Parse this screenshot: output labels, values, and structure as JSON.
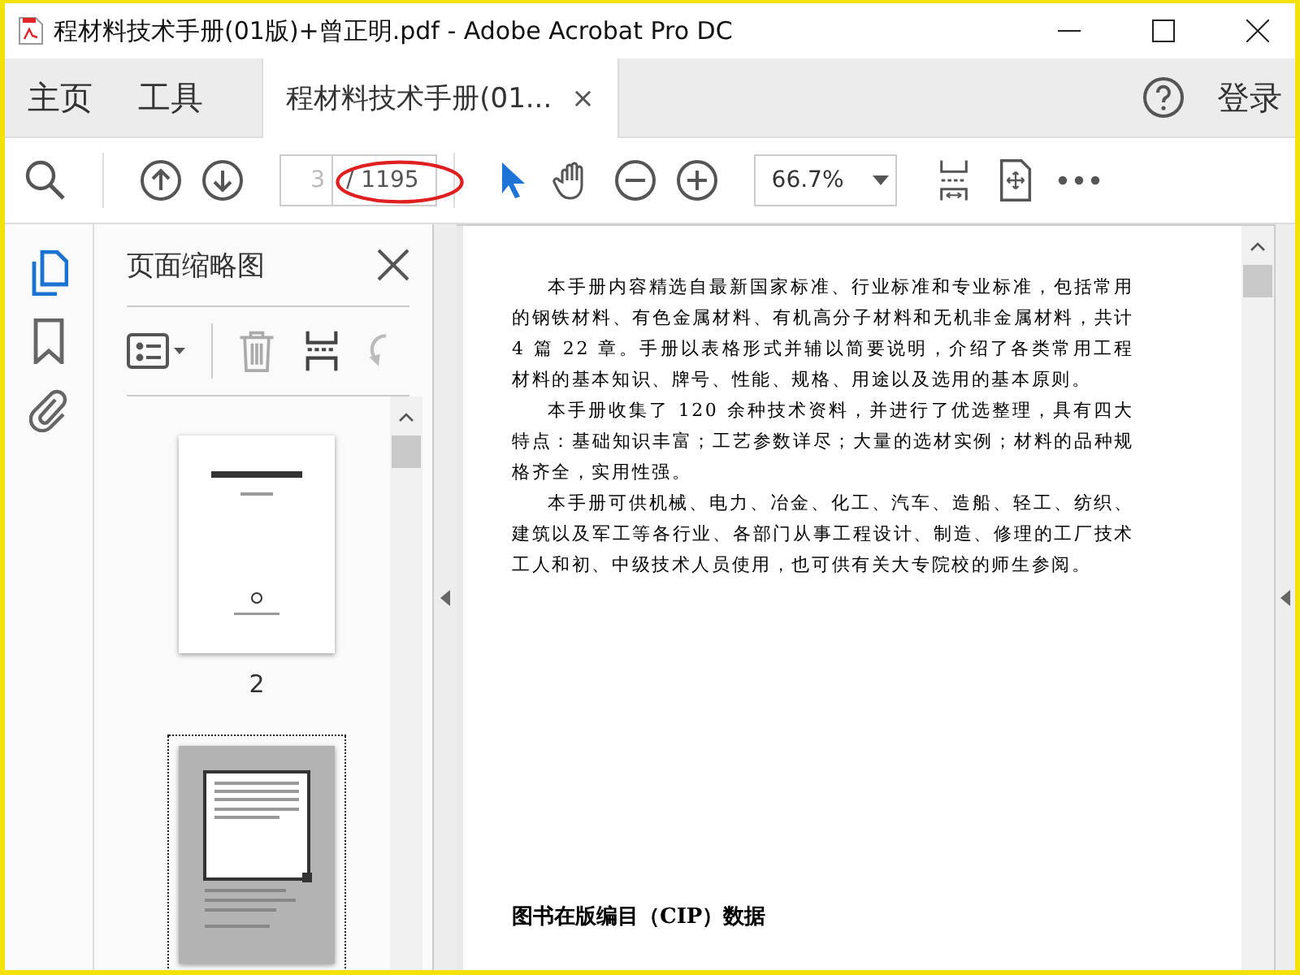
{
  "window": {
    "title": "程材料技术手册(01版)+曾正明.pdf - Adobe Acrobat Pro DC"
  },
  "nav": [
    {
      "label": "主页",
      "selected": false
    },
    {
      "label": "工具",
      "selected": false
    }
  ],
  "doc_tab": {
    "label": "程材料技术手册(01...",
    "close": "×",
    "selected": true
  },
  "signin": "登录",
  "toolbar": {
    "page_value": "3",
    "page_total": "/ 1195",
    "zoom": "66.7%"
  },
  "sidebar": {
    "items": [
      {
        "kind": "pages",
        "selected": true
      },
      {
        "kind": "bookmarks",
        "selected": false
      },
      {
        "kind": "attachments",
        "selected": false
      }
    ]
  },
  "panel": {
    "title": "页面缩略图",
    "thumbnails": [
      {
        "label": "2",
        "selected": false
      },
      {
        "selected": true
      }
    ]
  },
  "document": {
    "paragraphs": [
      "本手册内容精选自最新国家标准、行业标准和专业标准，包括常用的钢铁材料、有色金属材料、有机高分子材料和无机非金属材料，共计 4 篇 22 章。手册以表格形式并辅以简要说明，介绍了各类常用工程材料的基本知识、牌号、性能、规格、用途以及选用的基本原则。",
      "本手册收集了 120 余种技术资料，并进行了优选整理，具有四大特点：基础知识丰富；工艺参数详尽；大量的选材实例；材料的品种规格齐全，实用性强。",
      "本手册可供机械、电力、冶金、化工、汽车、造船、轻工、纺织、建筑以及军工等各行业、各部门从事工程设计、制造、修理的工厂技术工人和初、中级技术人员使用，也可供有关大专院校的师生参阅。"
    ],
    "cip_heading": "图书在版编目（CIP）数据"
  }
}
